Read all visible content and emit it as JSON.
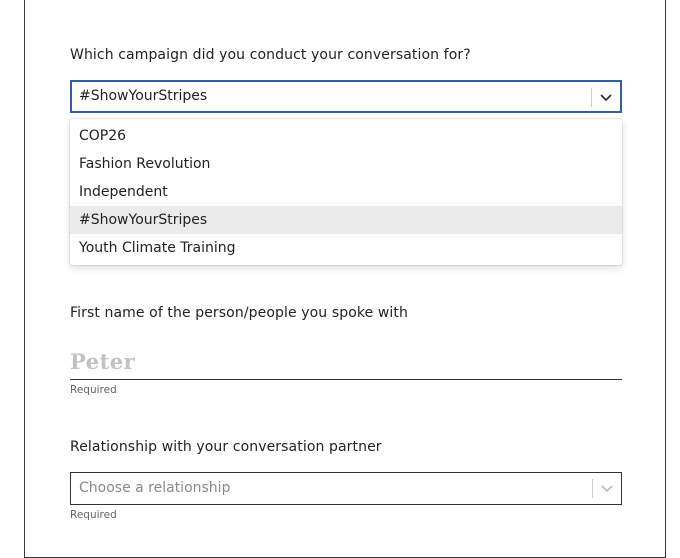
{
  "campaign": {
    "question": "Which campaign did you conduct your conversation for?",
    "selected_value": "#ShowYourStripes",
    "options": [
      {
        "label": "COP26",
        "selected": false
      },
      {
        "label": "Fashion Revolution",
        "selected": false
      },
      {
        "label": "Independent",
        "selected": false
      },
      {
        "label": "#ShowYourStripes",
        "selected": true
      },
      {
        "label": "Youth Climate Training",
        "selected": false
      }
    ]
  },
  "first_name": {
    "question": "First name of the person/people you spoke with",
    "placeholder": "Peter",
    "value": "",
    "hint": "Required"
  },
  "relationship": {
    "question": "Relationship with your conversation partner",
    "placeholder": "Choose a relationship",
    "hint": "Required"
  },
  "colors": {
    "focus_border": "#2f5fa8",
    "selected_option_bg": "#ebebeb",
    "placeholder_text": "#c2c2c2"
  },
  "icons": {
    "dropdown": "chevron-down-icon"
  }
}
